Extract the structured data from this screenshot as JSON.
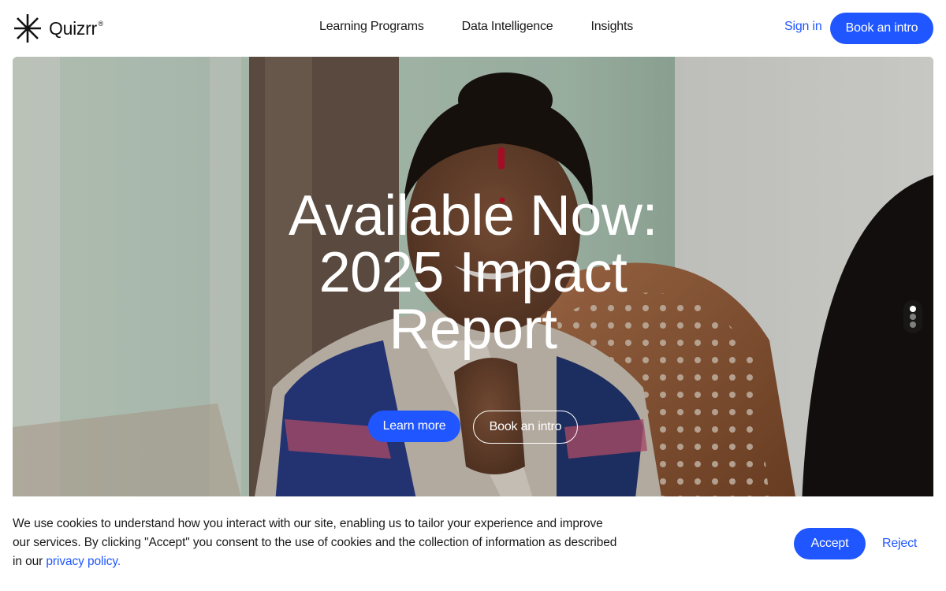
{
  "brand": {
    "name": "Quizrr",
    "trademark": "®",
    "logo_icon": "asterisk-logo-icon",
    "accent_color": "#1f56ff"
  },
  "nav": {
    "items": [
      {
        "label": "Learning Programs"
      },
      {
        "label": "Data Intelligence"
      },
      {
        "label": "Insights"
      }
    ],
    "sign_in": "Sign in",
    "cta": "Book an intro"
  },
  "hero": {
    "title_lines": [
      "Available Now:",
      "2025 Impact",
      "Report"
    ],
    "primary_button": "Learn more",
    "secondary_button": "Book an intro",
    "slides": {
      "count": 3,
      "active_index": 0
    }
  },
  "cookie_banner": {
    "text": "We use cookies to understand how you interact with our site, enabling us to tailor your experience and improve our services. By clicking \"Accept\" you consent to the use of cookies and the collection of information as described in our ",
    "link_text": "privacy policy.",
    "accept": "Accept",
    "reject": "Reject"
  }
}
